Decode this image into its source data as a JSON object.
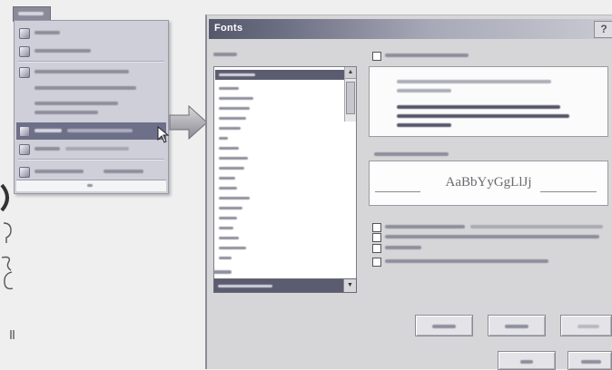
{
  "colors": {
    "page-bg": "#efeff0",
    "menu-bg": "#cfcfda",
    "highlight": "#6e6f88",
    "dialog-bg": "#d6d6d8",
    "title-dark": "#55576a",
    "selected": "#5c5c70"
  },
  "context_menu": {
    "pointer_icon": "mouse-cursor-icon"
  },
  "transition_arrow": {
    "icon": "right-arrow-icon"
  },
  "dialog": {
    "title": "Fonts",
    "help_icon": "help-icon",
    "help_glyph": "?",
    "preview_sample": "AaBbYyGgLlJj"
  }
}
